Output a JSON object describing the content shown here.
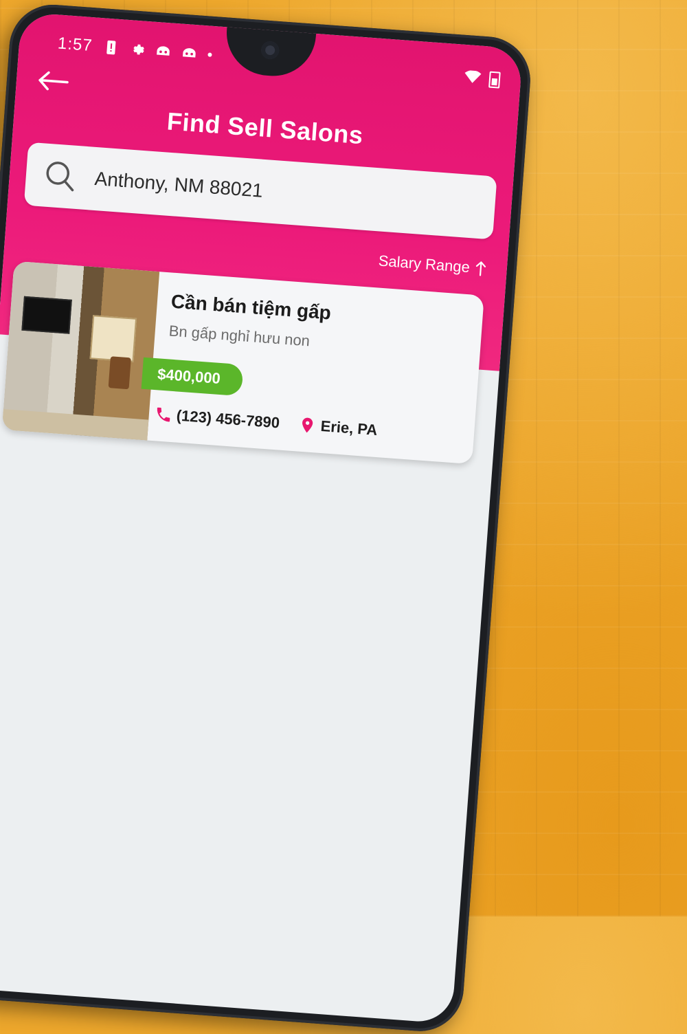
{
  "status_bar": {
    "time": "1:57"
  },
  "header": {
    "title": "Find Sell Salons"
  },
  "search": {
    "value": "Anthony, NM 88021",
    "placeholder": ""
  },
  "sort": {
    "label": "Salary Range"
  },
  "listings": [
    {
      "title": "Cần bán tiệm gấp",
      "subtitle": "Bn gấp nghỉ hưu non",
      "price": "$400,000",
      "phone": "(123) 456-7890",
      "location": "Erie, PA"
    }
  ],
  "colors": {
    "primary": "#E8176F",
    "price_badge": "#5BB62A",
    "background": "#ECEFF1"
  },
  "icons": [
    "back-arrow-icon",
    "search-icon",
    "arrow-up-icon",
    "phone-icon",
    "location-pin-icon",
    "wifi-icon",
    "battery-icon",
    "gear-icon"
  ]
}
